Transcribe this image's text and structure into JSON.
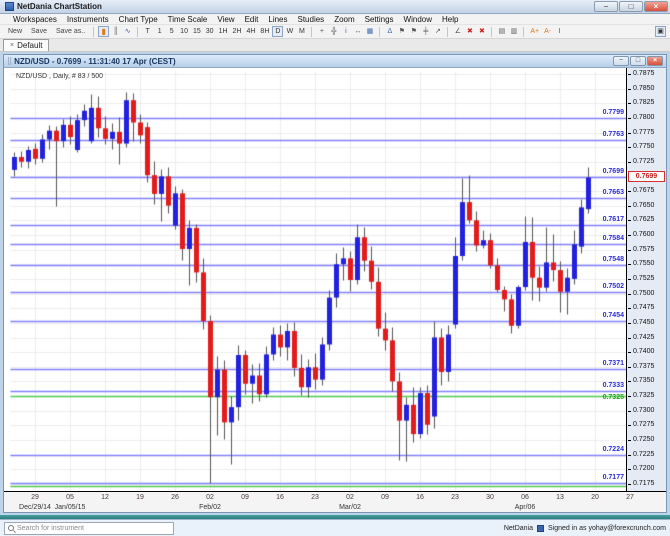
{
  "window": {
    "title": "NetDania ChartStation",
    "controls": [
      "minimize",
      "maximize",
      "close"
    ]
  },
  "menu": {
    "items": [
      "Workspaces",
      "Instruments",
      "Chart Type",
      "Time Scale",
      "View",
      "Edit",
      "Lines",
      "Studies",
      "Zoom",
      "Settings",
      "Window",
      "Help"
    ]
  },
  "toolbar": {
    "file_buttons": [
      "New",
      "Save",
      "Save as.."
    ],
    "chart_type_icons": [
      {
        "name": "candlestick-chart-icon",
        "glyph": "▮",
        "active": true,
        "class": "candle-glyph"
      },
      {
        "name": "bar-chart-icon",
        "glyph": "║",
        "active": false,
        "class": "dark"
      },
      {
        "name": "line-chart-icon",
        "glyph": "∿",
        "active": false,
        "class": "blue"
      }
    ],
    "timeframes": [
      "T",
      "1",
      "5",
      "10",
      "15",
      "30",
      "1H",
      "2H",
      "4H",
      "8H",
      "D",
      "W",
      "M"
    ],
    "active_timeframe": "D",
    "tool_icons": [
      {
        "name": "crosshair-icon",
        "glyph": "+",
        "class": "dark",
        "sep_before": true
      },
      {
        "name": "grid-icon",
        "glyph": "╬",
        "class": "dark"
      },
      {
        "name": "info-icon",
        "glyph": "i",
        "class": "blue"
      },
      {
        "name": "scroll-icon",
        "glyph": "↔",
        "class": "dark"
      },
      {
        "name": "export-icon",
        "glyph": "▦",
        "class": "blue"
      },
      {
        "name": "alert-bell-icon",
        "glyph": "Δ",
        "class": "blue",
        "sep_before": true
      },
      {
        "name": "trend-line-icon",
        "glyph": "⚑",
        "class": "dark"
      },
      {
        "name": "trend-channel-icon",
        "glyph": "⚑",
        "class": "dark"
      },
      {
        "name": "fibonacci-icon",
        "glyph": "╪",
        "class": "dark"
      },
      {
        "name": "ray-icon",
        "glyph": "↗",
        "class": "dark"
      },
      {
        "name": "angle-line-icon",
        "glyph": "∠",
        "class": "dark",
        "sep_before": true
      },
      {
        "name": "delete-icon",
        "glyph": "✖",
        "class": "red"
      },
      {
        "name": "delete-all-icon",
        "glyph": "✖",
        "class": "red"
      },
      {
        "name": "print-icon",
        "glyph": "▤",
        "class": "dark",
        "sep_before": true
      },
      {
        "name": "print-preview-icon",
        "glyph": "▥",
        "class": "dark"
      },
      {
        "name": "zoom-in-icon",
        "glyph": "A+",
        "class": "orange",
        "sep_before": true
      },
      {
        "name": "zoom-out-icon",
        "glyph": "A-",
        "class": "orange"
      },
      {
        "name": "measure-icon",
        "glyph": "Ι",
        "class": "dark"
      }
    ],
    "layout_button_glyph": "▣"
  },
  "tabs": {
    "items": [
      {
        "label": "Default",
        "close_glyph": "×",
        "active": true
      }
    ]
  },
  "chart_window": {
    "title": "NZD/USD - 0.7699 - 11:31:40 17 Apr (CEST)",
    "instrument_label": "NZD/USD , Daily, # 83 / 500",
    "controls": [
      "minimize",
      "restore",
      "close"
    ]
  },
  "status_bar": {
    "search_placeholder": "Search for instrument",
    "brand": "NetDania",
    "signed_in": "Signed in as yohay@forexcrunch.com"
  },
  "chart_data": {
    "type": "candlestick",
    "instrument": "NZD/USD",
    "timeframe": "Daily",
    "bars_shown_label": "# 83 / 500",
    "current_price": 0.7699,
    "colors": {
      "up": "#2121de",
      "down": "#e21b1b",
      "wick": "#555555",
      "grid": "#ececec",
      "sr_line": "#8181fb",
      "sr_label": "#2a2ae0",
      "green_line": "#4ec94e",
      "green_label": "#1ba51b"
    },
    "y_axis": {
      "price_top": 0.788,
      "price_bottom": 0.7163,
      "tick_labels": [
        "0.7875",
        "0.7850",
        "0.7825",
        "0.7800",
        "0.7775",
        "0.7750",
        "0.7725",
        "0.7700",
        "0.7675",
        "0.7650",
        "0.7625",
        "0.7600",
        "0.7575",
        "0.7550",
        "0.7525",
        "0.7500",
        "0.7475",
        "0.7450",
        "0.7425",
        "0.7400",
        "0.7375",
        "0.7350",
        "0.7325",
        "0.7300",
        "0.7275",
        "0.7250",
        "0.7225",
        "0.7200",
        "0.7175"
      ]
    },
    "x_axis": {
      "tick_bar_indices": [
        3,
        8,
        13,
        18,
        23,
        28,
        33,
        38,
        43,
        48,
        53,
        58,
        63,
        68,
        73,
        78,
        83,
        88
      ],
      "tick_labels": [
        "29",
        "05",
        "12",
        "19",
        "26",
        "02",
        "09",
        "16",
        "23",
        "02",
        "09",
        "16",
        "23",
        "30",
        "06",
        "13",
        "20",
        "27"
      ],
      "date_labels": [
        {
          "index": 3,
          "label": "Dec/29/14"
        },
        {
          "index": 8,
          "label": "Jan/05/15"
        },
        {
          "index": 28,
          "label": "Feb/02"
        },
        {
          "index": 48,
          "label": "Mar/02"
        },
        {
          "index": 73,
          "label": "Apr/06"
        }
      ]
    },
    "support_resistance_lines": [
      0.7799,
      0.7763,
      0.7699,
      0.7663,
      0.7617,
      0.7584,
      0.7548,
      0.7502,
      0.7454,
      0.7371,
      0.7333,
      0.7224,
      0.7177
    ],
    "green_lines": [
      {
        "value": 0.7325,
        "label": "0.7325"
      },
      {
        "value": 0.7171,
        "label": ""
      }
    ],
    "candles": [
      [
        0.7712,
        0.7742,
        0.77,
        0.7734
      ],
      [
        0.7734,
        0.7744,
        0.7716,
        0.7726
      ],
      [
        0.7726,
        0.7752,
        0.7714,
        0.7746
      ],
      [
        0.7748,
        0.7757,
        0.7722,
        0.7731
      ],
      [
        0.7731,
        0.7772,
        0.7725,
        0.7764
      ],
      [
        0.7764,
        0.7787,
        0.7747,
        0.7779
      ],
      [
        0.7779,
        0.7786,
        0.765,
        0.7761
      ],
      [
        0.7761,
        0.7798,
        0.775,
        0.7789
      ],
      [
        0.7789,
        0.7803,
        0.7756,
        0.7768
      ],
      [
        0.7746,
        0.7806,
        0.7741,
        0.7797
      ],
      [
        0.7797,
        0.7824,
        0.7786,
        0.7813
      ],
      [
        0.7761,
        0.784,
        0.7757,
        0.7818
      ],
      [
        0.7818,
        0.7838,
        0.7767,
        0.7783
      ],
      [
        0.7783,
        0.7803,
        0.7755,
        0.7765
      ],
      [
        0.7765,
        0.7792,
        0.7747,
        0.7777
      ],
      [
        0.7777,
        0.7801,
        0.7721,
        0.7757
      ],
      [
        0.7757,
        0.7845,
        0.7751,
        0.7831
      ],
      [
        0.7831,
        0.7843,
        0.7761,
        0.7793
      ],
      [
        0.7793,
        0.7806,
        0.7757,
        0.7771
      ],
      [
        0.7785,
        0.7793,
        0.7691,
        0.7703
      ],
      [
        0.7703,
        0.7726,
        0.7653,
        0.7671
      ],
      [
        0.7671,
        0.7713,
        0.7624,
        0.7701
      ],
      [
        0.7701,
        0.7716,
        0.7637,
        0.7651
      ],
      [
        0.7617,
        0.7683,
        0.7611,
        0.7672
      ],
      [
        0.7672,
        0.7679,
        0.7557,
        0.7577
      ],
      [
        0.7577,
        0.7626,
        0.7514,
        0.7613
      ],
      [
        0.7613,
        0.7619,
        0.7519,
        0.7537
      ],
      [
        0.7537,
        0.7561,
        0.7439,
        0.7454
      ],
      [
        0.7454,
        0.7464,
        0.7176,
        0.7324
      ],
      [
        0.7324,
        0.7393,
        0.7258,
        0.7371
      ],
      [
        0.7371,
        0.7386,
        0.7251,
        0.7281
      ],
      [
        0.7281,
        0.7326,
        0.7209,
        0.7307
      ],
      [
        0.7307,
        0.7412,
        0.7284,
        0.7396
      ],
      [
        0.7396,
        0.7403,
        0.7329,
        0.7347
      ],
      [
        0.7347,
        0.7379,
        0.7314,
        0.7361
      ],
      [
        0.7361,
        0.7381,
        0.7317,
        0.7329
      ],
      [
        0.7329,
        0.7411,
        0.7324,
        0.7397
      ],
      [
        0.7397,
        0.7443,
        0.7387,
        0.7431
      ],
      [
        0.7431,
        0.7446,
        0.7394,
        0.7409
      ],
      [
        0.7409,
        0.7449,
        0.7387,
        0.7437
      ],
      [
        0.7437,
        0.7451,
        0.7359,
        0.7374
      ],
      [
        0.7374,
        0.7397,
        0.7327,
        0.7341
      ],
      [
        0.7341,
        0.7389,
        0.7324,
        0.7375
      ],
      [
        0.7375,
        0.7399,
        0.7337,
        0.7354
      ],
      [
        0.7354,
        0.7426,
        0.7344,
        0.7414
      ],
      [
        0.7414,
        0.7506,
        0.7404,
        0.7494
      ],
      [
        0.7494,
        0.7569,
        0.7477,
        0.7551
      ],
      [
        0.7551,
        0.7579,
        0.7524,
        0.7561
      ],
      [
        0.7561,
        0.7573,
        0.7504,
        0.7524
      ],
      [
        0.7524,
        0.7619,
        0.7517,
        0.7597
      ],
      [
        0.7597,
        0.7613,
        0.7539,
        0.7557
      ],
      [
        0.7557,
        0.7581,
        0.7507,
        0.7521
      ],
      [
        0.7521,
        0.7546,
        0.7427,
        0.7441
      ],
      [
        0.7441,
        0.7469,
        0.7404,
        0.7421
      ],
      [
        0.7421,
        0.7443,
        0.7334,
        0.7351
      ],
      [
        0.7351,
        0.7367,
        0.7216,
        0.7284
      ],
      [
        0.7284,
        0.7323,
        0.7214,
        0.7311
      ],
      [
        0.7311,
        0.7341,
        0.7247,
        0.7261
      ],
      [
        0.7261,
        0.7341,
        0.7254,
        0.7331
      ],
      [
        0.7331,
        0.7344,
        0.7261,
        0.7277
      ],
      [
        0.7291,
        0.7453,
        0.7271,
        0.7426
      ],
      [
        0.7426,
        0.7441,
        0.7344,
        0.7367
      ],
      [
        0.7367,
        0.7446,
        0.7351,
        0.7431
      ],
      [
        0.7448,
        0.7597,
        0.7442,
        0.7565
      ],
      [
        0.7565,
        0.7698,
        0.7558,
        0.7657
      ],
      [
        0.7657,
        0.7703,
        0.7621,
        0.7626
      ],
      [
        0.7626,
        0.7641,
        0.7573,
        0.7583
      ],
      [
        0.7583,
        0.7609,
        0.7578,
        0.7592
      ],
      [
        0.7592,
        0.7604,
        0.7544,
        0.7549
      ],
      [
        0.7549,
        0.7561,
        0.7503,
        0.7507
      ],
      [
        0.7507,
        0.7513,
        0.7471,
        0.7491
      ],
      [
        0.7491,
        0.7499,
        0.7432,
        0.7446
      ],
      [
        0.7446,
        0.7515,
        0.7441,
        0.7512
      ],
      [
        0.7512,
        0.7633,
        0.7506,
        0.7589
      ],
      [
        0.7589,
        0.7631,
        0.7489,
        0.7528
      ],
      [
        0.7528,
        0.7547,
        0.7487,
        0.7511
      ],
      [
        0.7511,
        0.7613,
        0.7505,
        0.7554
      ],
      [
        0.7554,
        0.7601,
        0.7521,
        0.7541
      ],
      [
        0.7541,
        0.7556,
        0.7468,
        0.7504
      ],
      [
        0.7504,
        0.7543,
        0.7466,
        0.7528
      ],
      [
        0.7526,
        0.7608,
        0.7516,
        0.7585
      ],
      [
        0.7581,
        0.7662,
        0.757,
        0.7648
      ],
      [
        0.7645,
        0.7716,
        0.7638,
        0.7699
      ]
    ]
  }
}
